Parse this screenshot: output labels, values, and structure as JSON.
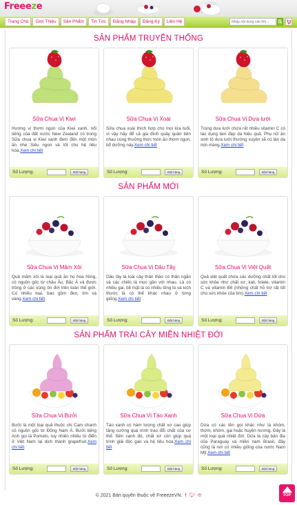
{
  "header": {
    "logo_text": "Freeeze",
    "nav": [
      "Trang Chủ",
      "Giới Thiệu",
      "Sản Phẩm",
      "Tin Tức",
      "Đăng Nhập",
      "Đăng Ký",
      "Liên Hệ"
    ],
    "search_placeholder": "Nhập nội dung cần tìm...",
    "cart_icon": "cart-icon",
    "search_icon": "search-icon"
  },
  "sections": [
    {
      "title": "SẢN PHẨM TRUYỀN THỐNG",
      "products": [
        {
          "name": "Sữa Chua Vị Kiwi",
          "desc": "Hương vị thơm ngon của Kiwi xanh, nổi tiếng của đất nước New Zealand có trong Sữa chua vị Kiwi xanh đem đến một món ăn nhẹ Siêu ngon và tốt cho hệ tiêu hóa.",
          "link": "Xem chi tiết",
          "qty_label": "Số Lượng:",
          "order": "Đặt hàng"
        },
        {
          "name": "Sữa Chua Vị Xoài",
          "desc": "Sữa chua xoài thích hợp cho mọi lứa tuổi, vì vậy hãy để cả gia đình quây quần bên nhau cùng thưởng thức món ăn thơm ngon, bổ dưỡng này.",
          "link": "Xem chi tiết",
          "qty_label": "Số Lượng:",
          "order": "Đặt hàng"
        },
        {
          "name": "Sữa Chua Vị Dưa lưới",
          "desc": "Trong dưa lưới chứa rất nhiều vitamin C có tác dụng làm đẹp da hiệu quả. Phụ nữ ăn sinh tố dưa lưới thường xuyên sẽ có làn da mịn màng.",
          "link": "Xem chi tiết",
          "qty_label": "Số Lượng:",
          "order": "Đặt hàng"
        }
      ]
    },
    {
      "title": "SẢN PHẨM MỚI",
      "products": [
        {
          "name": "Sữa Chua Vị Mâm Xôi",
          "desc": "Quả mâm xôi là loại quả ăn họ hoa hồng, có nguồn gốc từ châu Âu, Bắc Á và được trồng ở các vùng ôn đới trên toàn thế giới. Có nhiều loại, bao gồm đen, tím và vàng.",
          "link": "Xem chi tiết",
          "qty_label": "Số Lượng:",
          "order": "Đặt hàng"
        },
        {
          "name": "Sữa Chua Vị Dâu Tây",
          "desc": "Dâu tây là loài cây thân thảo có thân ngắn và các chiếc lá mọc gần với nhau. Là có nhiều gai, bề mặt lá có nhiều lông to và kích thước lá có thể khác nhau ở từng giống.",
          "link": "Xem chi tiết",
          "qty_label": "Số Lượng:",
          "order": "Đặt hàng"
        },
        {
          "name": "Sữa Chua Vị Việt Quất",
          "desc": "Quả việt quất chứa các dưỡng chất tốt cho sức khỏe như chất xơ, kali, folate, vitamin C và vitamin B6 (những chất hỗ trợ rất tốt cho sức khỏe của tim).",
          "link": "Xem chi tiết",
          "qty_label": "Số Lượng:",
          "order": "Đặt hàng"
        }
      ]
    },
    {
      "title": "SẢN PHẨM TRÁI CÂY MIỀN NHIỆT ĐỚI",
      "products": [
        {
          "name": "Sữa Chua Vị Bưởi",
          "desc": "Bưởi là một loại quả thuộc chi Cam chanh có nguồn gốc từ Đông Nam Á. Bưởi tiếng Anh gọi là Pomelo, tuy nhiên nhiều từ điển ở Việt Nam lại dịch thành grapefruit.",
          "link": "Xem chi tiết",
          "qty_label": "Số Lượng:",
          "order": "Đặt hàng"
        },
        {
          "name": "Sữa Chua Vị Táo Xanh",
          "desc": "Táo xanh có hàm lượng chất xơ cao giúp tăng cường quá trình trao đổi chất của cơ thể. Bên cạnh đó, chất xơ còn giúp quá trình giải độc gan và hệ tiêu hóa.",
          "link": "Xem chi tiết",
          "qty_label": "Số Lượng:",
          "order": "Đặt hàng"
        },
        {
          "name": "Sữa Chua Vị Dứa",
          "desc": "Dứa có các tên gọi khác như là khóm, thơm, khớm, gai hoặc huyền nương. Đây là một loại quả nhiệt đới. Dứa là cây bản địa của Paraguay và miền nam Brasil, đây cũng là nơi có nhiều giống của nước Nam Mỹ.",
          "link": "Xem chi tiết",
          "qty_label": "Số Lượng:",
          "order": "Đặt hàng"
        }
      ]
    }
  ],
  "footer": {
    "text": "© 2021 Bản quyền thuộc về FreeezeVN."
  },
  "top_button": {
    "label": "TOP"
  },
  "colors": {
    "accent": "#e30c68",
    "green": "#a8d13a"
  }
}
